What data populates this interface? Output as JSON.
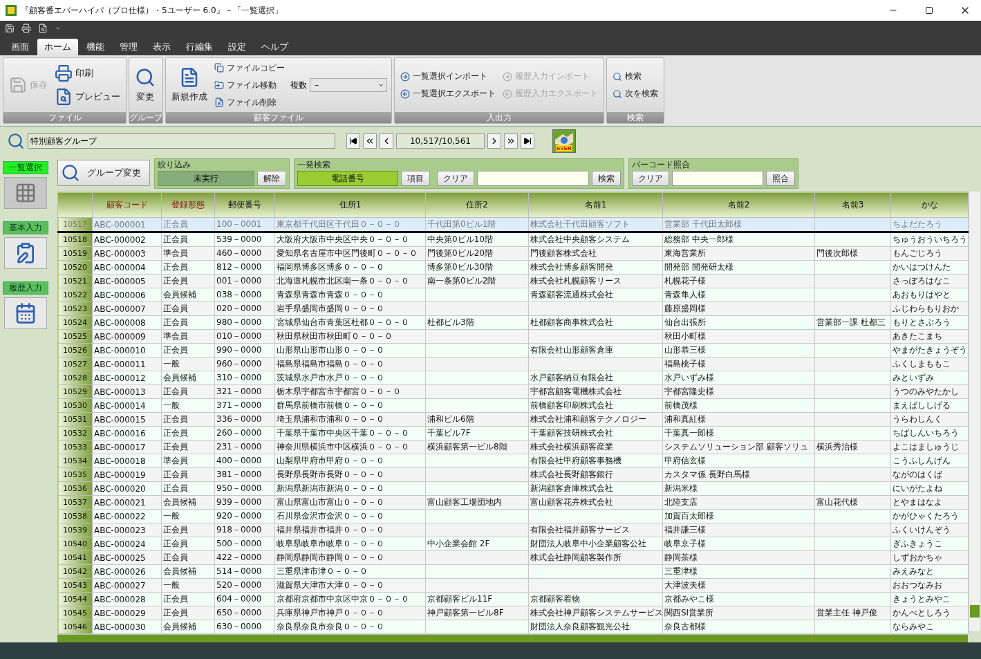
{
  "window": {
    "title": "『顧客番エバーハイパ（プロ仕様）・5ユーザー 6.0』－「一覧選択」"
  },
  "tabs": [
    {
      "label": "画面",
      "selected": false
    },
    {
      "label": "ホーム",
      "selected": true
    },
    {
      "label": "機能",
      "selected": false
    },
    {
      "label": "管理",
      "selected": false
    },
    {
      "label": "表示",
      "selected": false
    },
    {
      "label": "行編集",
      "selected": false
    },
    {
      "label": "設定",
      "selected": false
    },
    {
      "label": "ヘルプ",
      "selected": false
    }
  ],
  "ribbon": {
    "groups": [
      {
        "label": "ファイル",
        "columns": [
          [
            {
              "label": "保存",
              "kind": "wide",
              "disabled": true
            }
          ],
          [
            {
              "label": "印刷",
              "kind": "wide",
              "disabled": false
            },
            {
              "label": "プレビュー",
              "kind": "wide",
              "disabled": false
            }
          ]
        ]
      },
      {
        "label": "グループ",
        "columns": [
          [
            {
              "label": "変更",
              "kind": "large",
              "disabled": false
            }
          ]
        ]
      },
      {
        "label": "顧客ファイル",
        "columns": [
          [
            {
              "label": "新規作成",
              "kind": "large",
              "disabled": false
            }
          ],
          [
            {
              "label": "ファイルコピー",
              "kind": "small",
              "disabled": false
            },
            {
              "label": "ファイル移動",
              "kind": "small",
              "disabled": false
            },
            {
              "label": "ファイル削除",
              "kind": "small",
              "disabled": false
            }
          ],
          [
            {
              "label": "複数",
              "kind": "dropdown",
              "value": "－"
            }
          ]
        ]
      },
      {
        "label": "入出力",
        "columns": [
          [
            {
              "label": "一覧選択インポート",
              "kind": "small",
              "disabled": false
            },
            {
              "label": "一覧選択エクスポート",
              "kind": "small",
              "disabled": false
            }
          ],
          [
            {
              "label": "履歴入力インポート",
              "kind": "small",
              "disabled": true
            },
            {
              "label": "履歴入力エクスポート",
              "kind": "small",
              "disabled": true
            }
          ]
        ]
      },
      {
        "label": "検索",
        "columns": [
          [
            {
              "label": "検索",
              "kind": "small",
              "disabled": false
            },
            {
              "label": "次を検索",
              "kind": "small",
              "disabled": false
            }
          ]
        ]
      }
    ]
  },
  "navigator": {
    "group": "特別顧客グループ",
    "counter": "10,517/10,561",
    "logo_text": "EVER"
  },
  "side_panel": [
    {
      "label": "一覧選択",
      "selected": true
    },
    {
      "label": "基本入力",
      "selected": false
    },
    {
      "label": "履歴入力",
      "selected": false
    }
  ],
  "filters": {
    "group_change": "グループ変更",
    "narrow": {
      "title": "絞り込み",
      "status": "未実行",
      "clear": "解除"
    },
    "quick_search": {
      "title": "一発検索",
      "field": "電話番号",
      "item": "項目",
      "clear": "クリア",
      "search": "検索"
    },
    "barcode": {
      "title": "バーコード照合",
      "clear": "クリア",
      "match": "照合"
    }
  },
  "table": {
    "columns": [
      {
        "label": "顧客コード",
        "highlighted": true
      },
      {
        "label": "登録形態",
        "highlighted": true
      },
      {
        "label": "郵便番号",
        "highlighted": false
      },
      {
        "label": "住所1",
        "highlighted": false
      },
      {
        "label": "住所2",
        "highlighted": false
      },
      {
        "label": "名前1",
        "highlighted": false
      },
      {
        "label": "名前2",
        "highlighted": false
      },
      {
        "label": "名前3",
        "highlighted": false
      },
      {
        "label": "かな",
        "highlighted": false
      }
    ],
    "rows": [
      {
        "no": "10517",
        "selected": true,
        "cells": [
          "ABC-000001",
          "正会員",
          "100－0001",
          "東京都千代田区千代田０－０－０",
          "千代田第0ビル1階",
          "株式会社千代田顧客ソフト",
          "営業部 千代田太郎様",
          null,
          "ちよだたろう"
        ]
      },
      {
        "no": "10518",
        "selected": false,
        "cells": [
          "ABC-000002",
          "正会員",
          "539－0000",
          "大阪府大阪市中央区中央０－０－０",
          "中央第0ビル10階",
          "株式会社中央顧客システム",
          "総務部 中央一郎様",
          null,
          "ちゅうおういちろう"
        ]
      },
      {
        "no": "10519",
        "selected": false,
        "cells": [
          "ABC-000003",
          "準会員",
          "460－0000",
          "愛知県名古屋市中区門後町０－０－０",
          "門後第0ビル20階",
          "門後顧客株式会社",
          "東海営業所",
          "門後次郎様",
          "もんごじろう"
        ]
      },
      {
        "no": "10520",
        "selected": false,
        "cells": [
          "ABC-000004",
          "正会員",
          "812－0000",
          "福岡県博多区博多０－０－０",
          "博多第0ビル30階",
          "株式会社博多顧客開発",
          "開発部 開発研太様",
          null,
          "かいはつけんた"
        ]
      },
      {
        "no": "10521",
        "selected": false,
        "cells": [
          "ABC-000005",
          "正会員",
          "001－0000",
          "北海道札幌市北区南一条０－０－０",
          "南一条第0ビル2階",
          "株式会社札幌顧客リース",
          "札幌花子様",
          null,
          "さっぽろはなこ"
        ]
      },
      {
        "no": "10522",
        "selected": false,
        "cells": [
          "ABC-000006",
          "会員候補",
          "038－0000",
          "青森県青森市青森０－０－０",
          null,
          "青森顧客流通株式会社",
          "青森隼人様",
          null,
          "あおもりはやと"
        ]
      },
      {
        "no": "10523",
        "selected": false,
        "cells": [
          "ABC-000007",
          "正会員",
          "020－0000",
          "岩手県盛岡市盛岡０－０－０",
          null,
          null,
          "藤原盛岡様",
          null,
          "ふじわらもりおか"
        ]
      },
      {
        "no": "10524",
        "selected": false,
        "cells": [
          "ABC-000008",
          "正会員",
          "980－0000",
          "宮城県仙台市青葉区杜都０－０－０",
          "杜都ビル3階",
          "杜都顧客商事株式会社",
          "仙台出張所",
          "営業部一課 杜都三",
          "もりとさぶろう"
        ]
      },
      {
        "no": "10525",
        "selected": false,
        "cells": [
          "ABC-000009",
          "準会員",
          "010－0000",
          "秋田県秋田市秋田町０－０－０",
          null,
          null,
          "秋田小町様",
          null,
          "あきたこまち"
        ]
      },
      {
        "no": "10526",
        "selected": false,
        "cells": [
          "ABC-000010",
          "正会員",
          "990－0000",
          "山形県山形市山形０－０－０",
          null,
          "有限会社山形顧客倉庫",
          "山形恭三様",
          null,
          "やまがたきょうぞう"
        ]
      },
      {
        "no": "10527",
        "selected": false,
        "cells": [
          "ABC-000011",
          "一般",
          "960－0000",
          "福島県福島市福島０－０－０",
          null,
          null,
          "福島桃子様",
          null,
          "ふくしまももこ"
        ]
      },
      {
        "no": "10528",
        "selected": false,
        "cells": [
          "ABC-000012",
          "会員候補",
          "310－0000",
          "茨城県水戸市水戸０－０－０",
          null,
          "水戸顧客納豆有限会社",
          "水戸いずみ様",
          null,
          "みといずみ"
        ]
      },
      {
        "no": "10529",
        "selected": false,
        "cells": [
          "ABC-000013",
          "正会員",
          "321－0000",
          "栃木県宇都宮市宇都宮０－０－０",
          null,
          "宇都宮顧客電機株式会社",
          "宇都宮隆史様",
          null,
          "うつのみやたかし"
        ]
      },
      {
        "no": "10530",
        "selected": false,
        "cells": [
          "ABC-000014",
          "一般",
          "371－0000",
          "群馬県前橋市前橋０－０－０",
          null,
          "前橋顧客印刷株式会社",
          "前橋茂様",
          null,
          "まえばししげる"
        ]
      },
      {
        "no": "10531",
        "selected": false,
        "cells": [
          "ABC-000015",
          "正会員",
          "336－0000",
          "埼玉県浦和市浦和０－０－０",
          "浦和ビル6階",
          "株式会社浦和顧客テクノロジー",
          "浦和真紅様",
          null,
          "うらわしんく"
        ]
      },
      {
        "no": "10532",
        "selected": false,
        "cells": [
          "ABC-000016",
          "正会員",
          "260－0000",
          "千葉県千葉市中央区千葉０－０－０",
          "千葉ビル7F",
          "千葉顧客技研株式会社",
          "千葉真一郎様",
          null,
          "ちばしんいちろう"
        ]
      },
      {
        "no": "10533",
        "selected": false,
        "cells": [
          "ABC-000017",
          "正会員",
          "231－0000",
          "神奈川県横浜市中区横浜０－０－０",
          "横浜顧客第一ビル8階",
          "株式会社横浜顧客産業",
          "システムソリューション部 顧客ソリュ",
          "横浜秀治様",
          "よこはましゅうじ"
        ]
      },
      {
        "no": "10534",
        "selected": false,
        "cells": [
          "ABC-000018",
          "準会員",
          "400－0000",
          "山梨県甲府市甲府０－０－０",
          null,
          "有限会社甲府顧客事務機",
          "甲府信玄様",
          null,
          "こうふしんげん"
        ]
      },
      {
        "no": "10535",
        "selected": false,
        "cells": [
          "ABC-000019",
          "正会員",
          "381－0000",
          "長野県長野市長野０－０－０",
          null,
          "株式会社長野顧客銀行",
          "カスタマ係 長野白馬様",
          null,
          "ながのはくば"
        ]
      },
      {
        "no": "10536",
        "selected": false,
        "cells": [
          "ABC-000020",
          "正会員",
          "950－0000",
          "新潟県新潟市新潟０－０－０",
          null,
          "新潟顧客倉庫株式会社",
          "新潟米様",
          null,
          "にいがたよね"
        ]
      },
      {
        "no": "10537",
        "selected": false,
        "cells": [
          "ABC-000021",
          "会員候補",
          "939－0000",
          "富山県富山市富山０－０－０",
          "富山顧客工場団地内",
          "富山顧客花卉株式会社",
          "北陸支店",
          "富山花代様",
          "とやまはなよ"
        ]
      },
      {
        "no": "10538",
        "selected": false,
        "cells": [
          "ABC-000022",
          "一般",
          "920－0000",
          "石川県金沢市金沢０－０－０",
          null,
          null,
          "加賀百太郎様",
          null,
          "かがひゃくたろう"
        ]
      },
      {
        "no": "10539",
        "selected": false,
        "cells": [
          "ABC-000023",
          "正会員",
          "918－0000",
          "福井県福井市福井０－０－０",
          null,
          "有限会社福井顧客サービス",
          "福井謙三様",
          null,
          "ふくいけんぞう"
        ]
      },
      {
        "no": "10540",
        "selected": false,
        "cells": [
          "ABC-000024",
          "正会員",
          "500－0000",
          "岐阜県岐阜市岐阜０－０－０",
          "中小企業会館 2F",
          "財団法人岐阜中小企業顧客公社",
          "岐阜京子様",
          null,
          "ぎふきょうこ"
        ]
      },
      {
        "no": "10541",
        "selected": false,
        "cells": [
          "ABC-000025",
          "正会員",
          "422－0000",
          "静岡県静岡市静岡０－０－０",
          null,
          "株式会社静岡顧客製作所",
          "静岡茶様",
          null,
          "しずおかちゃ"
        ]
      },
      {
        "no": "10542",
        "selected": false,
        "cells": [
          "ABC-000026",
          "会員候補",
          "514－0000",
          "三重県津市津０－０－０",
          null,
          null,
          "三重津様",
          null,
          "みえみなと"
        ]
      },
      {
        "no": "10543",
        "selected": false,
        "cells": [
          "ABC-000027",
          "一般",
          "520－0000",
          "滋賀県大津市大津０－０－０",
          null,
          null,
          "大津波夫様",
          null,
          "おおつなみお"
        ]
      },
      {
        "no": "10544",
        "selected": false,
        "cells": [
          "ABC-000028",
          "正会員",
          "604－0000",
          "京都府京都市中京区中京０－０－０",
          "京都顧客ビル11F",
          "京都顧客着物",
          "京都みやこ様",
          null,
          "きょうとみやこ"
        ]
      },
      {
        "no": "10545",
        "selected": false,
        "cells": [
          "ABC-000029",
          "正会員",
          "650－0000",
          "兵庫県神戸市神戸０－０－０",
          "神戸顧客第一ビル8F",
          "株式会社神戸顧客システムサービス",
          "関西SI営業所",
          "営業主任 神戸俊",
          "かんべとしろう"
        ]
      },
      {
        "no": "10546",
        "selected": false,
        "cells": [
          "ABC-000030",
          "会員候補",
          "630－0000",
          "奈良県奈良市奈良０－０－０",
          null,
          "財団法人奈良顧客観光公社",
          "奈良古都様",
          null,
          "ならみやこ"
        ]
      }
    ]
  }
}
